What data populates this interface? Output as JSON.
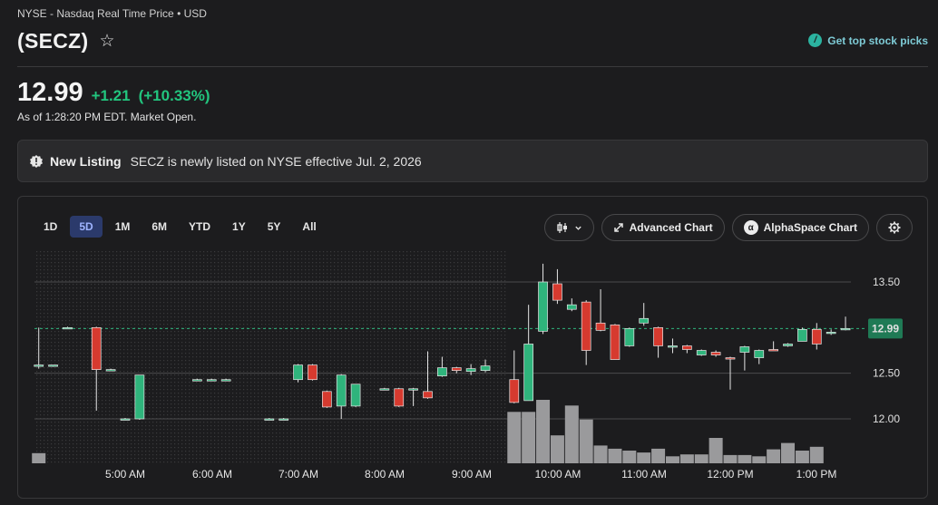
{
  "header": {
    "exchange": "NYSE - Nasdaq Real Time Price • USD",
    "ticker": "(SECZ)",
    "star_icon": "star-outline-icon",
    "top_picks_label": "Get top stock picks",
    "top_picks_icon": "bolt-icon"
  },
  "quote": {
    "price": "12.99",
    "change": "+1.21",
    "change_pct": "(+10.33%)",
    "as_of": "As of 1:28:20 PM EDT. Market Open.",
    "positive_color": "#22c57e"
  },
  "listing_banner": {
    "title": "New Listing",
    "message": "SECZ is newly listed on NYSE effective Jul. 2, 2026",
    "icon": "badge-icon"
  },
  "chart_controls": {
    "ranges": [
      "1D",
      "5D",
      "1M",
      "6M",
      "YTD",
      "1Y",
      "5Y",
      "All"
    ],
    "active_range": "5D",
    "chart_type_icon": "candlestick-icon",
    "advanced_label": "Advanced Chart",
    "alphaspace_label": "AlphaSpace Chart",
    "settings_icon": "gear-icon"
  },
  "chart_data": {
    "type": "candlestick",
    "y_ticks": [
      "13.50",
      "12.50",
      "12.00"
    ],
    "ylim": [
      11.5,
      14.0
    ],
    "last_price": 12.99,
    "last_price_label": "12.99",
    "prev_close_line": 12.99,
    "x_ticks": [
      "5:00 AM",
      "6:00 AM",
      "7:00 AM",
      "8:00 AM",
      "9:00 AM",
      "10:00 AM",
      "11:00 AM",
      "12:00 PM",
      "1:00 PM"
    ],
    "pre_market_end": "9:30 AM",
    "up_color": "#2fb47c",
    "down_color": "#d63a2f",
    "candles": [
      {
        "t": "4:00",
        "o": 12.58,
        "h": 13.0,
        "l": 12.55,
        "c": 12.59
      },
      {
        "t": "4:10",
        "o": 12.58,
        "h": 12.59,
        "l": 12.57,
        "c": 12.59
      },
      {
        "t": "4:20",
        "o": 13.0,
        "h": 13.01,
        "l": 12.99,
        "c": 13.0
      },
      {
        "t": "4:40",
        "o": 13.0,
        "h": 13.01,
        "l": 12.09,
        "c": 12.54
      },
      {
        "t": "4:50",
        "o": 12.54,
        "h": 12.55,
        "l": 12.53,
        "c": 12.54
      },
      {
        "t": "5:00",
        "o": 12.0,
        "h": 12.01,
        "l": 11.99,
        "c": 12.0
      },
      {
        "t": "5:10",
        "o": 12.0,
        "h": 12.48,
        "l": 11.99,
        "c": 12.48
      },
      {
        "t": "5:50",
        "o": 12.43,
        "h": 12.44,
        "l": 12.42,
        "c": 12.43
      },
      {
        "t": "6:00",
        "o": 12.43,
        "h": 12.44,
        "l": 12.42,
        "c": 12.43
      },
      {
        "t": "6:10",
        "o": 12.43,
        "h": 12.44,
        "l": 12.42,
        "c": 12.43
      },
      {
        "t": "6:40",
        "o": 12.0,
        "h": 12.01,
        "l": 11.99,
        "c": 12.0
      },
      {
        "t": "6:50",
        "o": 12.0,
        "h": 12.01,
        "l": 11.99,
        "c": 12.0
      },
      {
        "t": "7:00",
        "o": 12.43,
        "h": 12.6,
        "l": 12.4,
        "c": 12.59
      },
      {
        "t": "7:10",
        "o": 12.59,
        "h": 12.6,
        "l": 12.42,
        "c": 12.43
      },
      {
        "t": "7:20",
        "o": 12.3,
        "h": 12.31,
        "l": 12.12,
        "c": 12.13
      },
      {
        "t": "7:30",
        "o": 12.14,
        "h": 12.49,
        "l": 12.0,
        "c": 12.48
      },
      {
        "t": "7:40",
        "o": 12.14,
        "h": 12.38,
        "l": 12.13,
        "c": 12.38
      },
      {
        "t": "8:00",
        "o": 12.33,
        "h": 12.34,
        "l": 12.32,
        "c": 12.33
      },
      {
        "t": "8:10",
        "o": 12.33,
        "h": 12.34,
        "l": 12.13,
        "c": 12.14
      },
      {
        "t": "8:20",
        "o": 12.33,
        "h": 12.34,
        "l": 12.14,
        "c": 12.33
      },
      {
        "t": "8:30",
        "o": 12.3,
        "h": 12.74,
        "l": 12.22,
        "c": 12.23
      },
      {
        "t": "8:40",
        "o": 12.47,
        "h": 12.68,
        "l": 12.46,
        "c": 12.56
      },
      {
        "t": "8:50",
        "o": 12.56,
        "h": 12.57,
        "l": 12.5,
        "c": 12.53
      },
      {
        "t": "9:00",
        "o": 12.52,
        "h": 12.6,
        "l": 12.48,
        "c": 12.55
      },
      {
        "t": "9:10",
        "o": 12.53,
        "h": 12.65,
        "l": 12.51,
        "c": 12.58
      },
      {
        "t": "9:30",
        "o": 12.43,
        "h": 12.75,
        "l": 12.17,
        "c": 12.18
      },
      {
        "t": "9:40",
        "o": 12.2,
        "h": 13.25,
        "l": 12.2,
        "c": 12.82
      },
      {
        "t": "9:50",
        "o": 12.96,
        "h": 13.7,
        "l": 12.93,
        "c": 13.5
      },
      {
        "t": "10:00",
        "o": 13.48,
        "h": 13.64,
        "l": 13.26,
        "c": 13.3
      },
      {
        "t": "10:10",
        "o": 13.2,
        "h": 13.32,
        "l": 13.18,
        "c": 13.25
      },
      {
        "t": "10:20",
        "o": 13.28,
        "h": 13.3,
        "l": 12.59,
        "c": 12.75
      },
      {
        "t": "10:30",
        "o": 13.05,
        "h": 13.42,
        "l": 12.96,
        "c": 12.97
      },
      {
        "t": "10:40",
        "o": 13.03,
        "h": 13.04,
        "l": 12.65,
        "c": 12.65
      },
      {
        "t": "10:50",
        "o": 12.8,
        "h": 13.0,
        "l": 12.79,
        "c": 12.99
      },
      {
        "t": "11:00",
        "o": 13.05,
        "h": 13.27,
        "l": 13.02,
        "c": 13.1
      },
      {
        "t": "11:10",
        "o": 13.0,
        "h": 13.01,
        "l": 12.67,
        "c": 12.8
      },
      {
        "t": "11:20",
        "o": 12.79,
        "h": 12.88,
        "l": 12.72,
        "c": 12.8
      },
      {
        "t": "11:30",
        "o": 12.8,
        "h": 12.81,
        "l": 12.72,
        "c": 12.76
      },
      {
        "t": "11:40",
        "o": 12.7,
        "h": 12.76,
        "l": 12.69,
        "c": 12.75
      },
      {
        "t": "11:50",
        "o": 12.73,
        "h": 12.75,
        "l": 12.68,
        "c": 12.7
      },
      {
        "t": "12:00",
        "o": 12.67,
        "h": 12.68,
        "l": 12.32,
        "c": 12.66
      },
      {
        "t": "12:10",
        "o": 12.73,
        "h": 12.8,
        "l": 12.53,
        "c": 12.79
      },
      {
        "t": "12:20",
        "o": 12.67,
        "h": 12.76,
        "l": 12.6,
        "c": 12.75
      },
      {
        "t": "12:30",
        "o": 12.76,
        "h": 12.85,
        "l": 12.75,
        "c": 12.75
      },
      {
        "t": "12:40",
        "o": 12.8,
        "h": 12.83,
        "l": 12.79,
        "c": 12.82
      },
      {
        "t": "12:50",
        "o": 12.85,
        "h": 13.0,
        "l": 12.85,
        "c": 12.98
      },
      {
        "t": "1:00",
        "o": 12.98,
        "h": 13.05,
        "l": 12.76,
        "c": 12.82
      },
      {
        "t": "1:10",
        "o": 12.94,
        "h": 12.98,
        "l": 12.92,
        "c": 12.95
      },
      {
        "t": "1:20",
        "o": 12.98,
        "h": 13.12,
        "l": 12.97,
        "c": 12.99
      }
    ],
    "volume": [
      0.16,
      0.0,
      0.0,
      0.0,
      0.0,
      0.0,
      0.0,
      0.0,
      0.0,
      0.0,
      0.0,
      0.0,
      0.0,
      0.0,
      0.0,
      0.0,
      0.0,
      0.0,
      0.0,
      0.0,
      0.0,
      0.0,
      0.0,
      0.0,
      0.0,
      0.81,
      0.81,
      1.0,
      0.44,
      0.91,
      0.69,
      0.28,
      0.23,
      0.2,
      0.17,
      0.23,
      0.11,
      0.14,
      0.14,
      0.4,
      0.13,
      0.13,
      0.11,
      0.22,
      0.32,
      0.2,
      0.26
    ]
  }
}
